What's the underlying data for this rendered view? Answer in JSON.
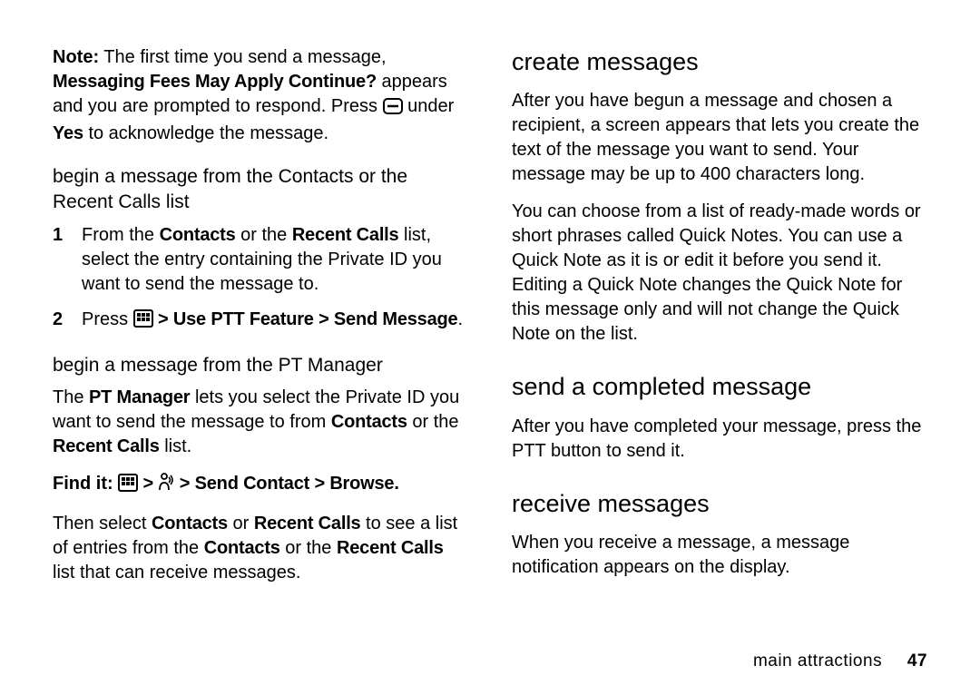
{
  "left": {
    "note": {
      "label": "Note:",
      "text1": " The first time you send a message, ",
      "bold1": "Messaging Fees May Apply Continue?",
      "text2": " appears and you are prompted to respond. Press ",
      "text3": " under ",
      "bold2": "Yes",
      "text4": " to acknowledge the message."
    },
    "sub1": "begin a message from the Contacts or the Recent Calls list",
    "step1": {
      "a": "From the ",
      "b": "Contacts",
      "c": " or the ",
      "d": "Recent Calls",
      "e": " list, select the entry containing the Private ID you want to send the message to."
    },
    "step2": {
      "a": "Press ",
      "b": " > ",
      "c": "Use PTT Feature",
      "d": " > ",
      "e": "Send Message",
      "f": "."
    },
    "sub2": "begin a message from the PT Manager",
    "pt": {
      "a": "The ",
      "b": "PT Manager",
      "c": " lets you select the Private ID you want to send the message to from ",
      "d": "Contacts",
      "e": " or the ",
      "f": "Recent Calls",
      "g": " list."
    },
    "findit": {
      "label": "Find it:",
      "b": " > ",
      "c": " > ",
      "d": "Send Contact",
      "e": " > ",
      "f": "Browse",
      "g": "."
    },
    "then": {
      "a": "Then select ",
      "b": "Contacts",
      "c": " or ",
      "d": "Recent Calls",
      "e": " to see a list of entries from the ",
      "f": "Contacts",
      "g": " or the ",
      "h": "Recent Calls",
      "i": " list that can receive messages."
    }
  },
  "right": {
    "h_create": "create messages",
    "create_p1": "After you have begun a message and chosen a recipient, a screen appears that lets you create the text of the message you want to send. Your message may be up to 400 characters long.",
    "create_p2": "You can choose from a list of ready-made words or short phrases called Quick Notes. You can use a Quick Note as it is or edit it before you send it. Editing a Quick Note changes the Quick Note for this message only and will not change the Quick Note on the list.",
    "h_send": "send a completed message",
    "send_p1": "After you have completed your message, press the PTT button to send it.",
    "h_receive": "receive messages",
    "receive_p1": "When you receive a message, a message notification appears on the display."
  },
  "footer": {
    "section": "main attractions",
    "page": "47"
  }
}
